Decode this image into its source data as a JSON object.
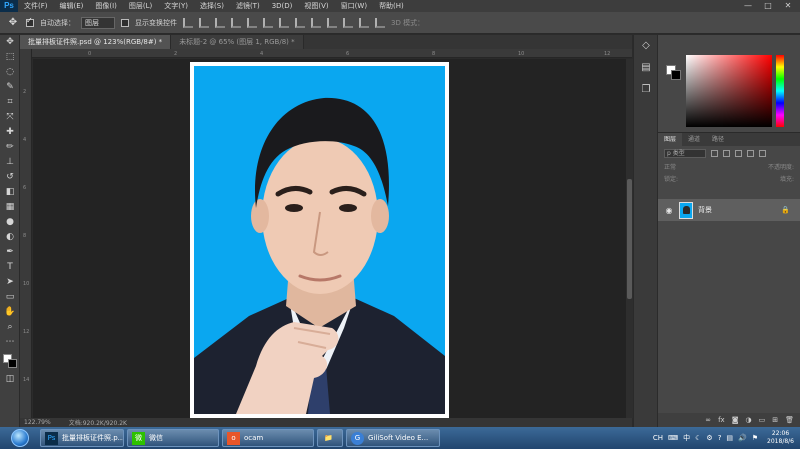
{
  "app": {
    "logo": "Ps"
  },
  "menu": [
    "文件(F)",
    "编辑(E)",
    "图像(I)",
    "图层(L)",
    "文字(Y)",
    "选择(S)",
    "滤镜(T)",
    "3D(D)",
    "视图(V)",
    "窗口(W)",
    "帮助(H)"
  ],
  "window_controls": {
    "minimize": "—",
    "maximize": "□",
    "close": "✕"
  },
  "options": {
    "auto_select_label": "自动选择：",
    "auto_select_value": "图层",
    "show_transform_label": "显示变换控件",
    "mode3d_label": "3D 模式："
  },
  "tabs": [
    {
      "label": "批量排板证件照.psd @ 123%(RGB/8#) *"
    },
    {
      "label": "未标题-2 @ 65% (图层 1, RGB/8) *"
    }
  ],
  "tools": [
    "move-icon",
    "marquee-icon",
    "lasso-icon",
    "quick-select-icon",
    "crop-icon",
    "eyedropper-icon",
    "healing-icon",
    "brush-icon",
    "stamp-icon",
    "history-brush-icon",
    "eraser-icon",
    "gradient-icon",
    "blur-icon",
    "dodge-icon",
    "pen-icon",
    "type-icon",
    "path-select-icon",
    "shape-icon",
    "hand-icon",
    "zoom-icon",
    "more-icon"
  ],
  "ruler": {
    "h_ticks": [
      "0",
      "2",
      "4",
      "6",
      "8",
      "10",
      "12"
    ],
    "v_ticks": [
      "2",
      "4",
      "6",
      "8",
      "10",
      "12",
      "14"
    ]
  },
  "status": {
    "zoom": "122.79%",
    "doc_info": "文档:920.2K/920.2K"
  },
  "layers": {
    "tabs": [
      "图层",
      "通道",
      "路径"
    ],
    "filter_label": "p 类型",
    "blend_mode": "正常",
    "opacity_label": "不透明度:",
    "lock_label": "锁定:",
    "fill_label": "填充:",
    "layer_name": "背景"
  },
  "taskbar": {
    "items": [
      {
        "label": "批量排板证件照.p...",
        "icon": "Ps"
      },
      {
        "label": "微信",
        "icon": "微"
      },
      {
        "label": "ocam",
        "icon": "o"
      },
      {
        "label": "",
        "icon": "📁"
      },
      {
        "label": "GiliSoft Video E...",
        "icon": "G"
      }
    ],
    "tray_ime": "CH",
    "tray_zh": "中",
    "time": "22:06",
    "date": "2018/8/6"
  }
}
